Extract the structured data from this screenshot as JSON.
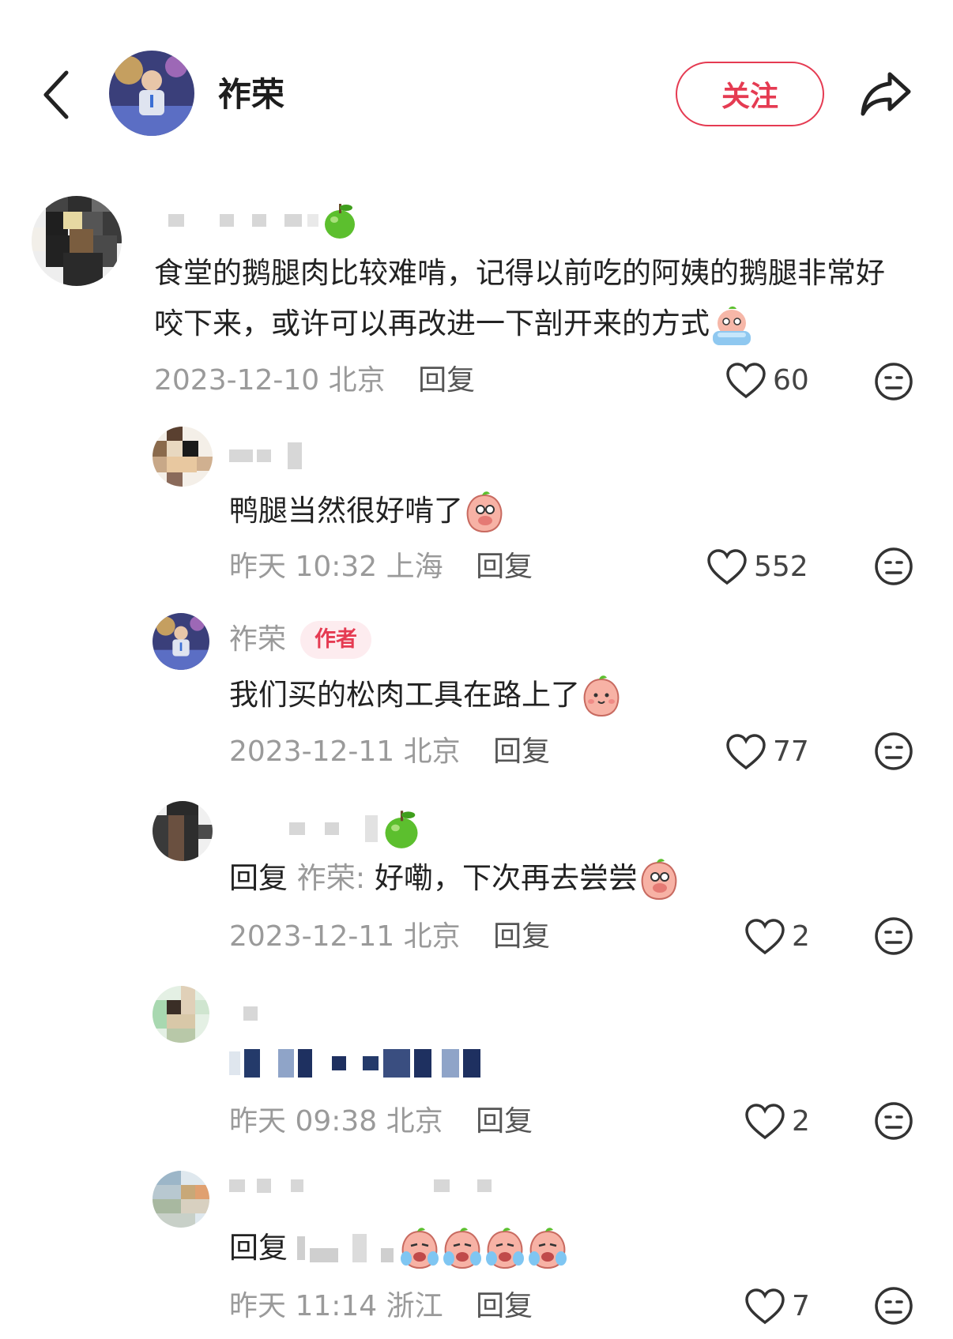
{
  "header": {
    "author_name": "祚荣",
    "follow_label": "关注"
  },
  "comments": [
    {
      "text": "食堂的鹅腿肉比较难啃，记得以前吃的阿姨的鹅腿非常好咬下来，或许可以再改进一下剖开来的方式",
      "date": "2023-12-10",
      "location": "北京",
      "reply_label": "回复",
      "likes": "60"
    },
    {
      "text": "鸭腿当然很好啃了",
      "date": "昨天 10:32",
      "location": "上海",
      "reply_label": "回复",
      "likes": "552"
    },
    {
      "username": "祚荣",
      "badge": "作者",
      "text": "我们买的松肉工具在路上了",
      "date": "2023-12-11",
      "location": "北京",
      "reply_label": "回复",
      "likes": "77"
    },
    {
      "reply_prefix": "回复",
      "reply_to": "祚荣:",
      "text": "好嘞，下次再去尝尝",
      "date": "2023-12-11",
      "location": "北京",
      "reply_label": "回复",
      "likes": "2"
    },
    {
      "date": "昨天 09:38",
      "location": "北京",
      "reply_label": "回复",
      "likes": "2"
    },
    {
      "reply_prefix": "回复",
      "date": "昨天 11:14",
      "location": "浙江",
      "reply_label": "回复",
      "likes": "7"
    }
  ],
  "colors": {
    "accent": "#e53b52",
    "muted_text": "#9a9a9a",
    "badge_bg": "#fdecef"
  },
  "icons": [
    "back-arrow-icon",
    "share-icon",
    "heart-icon",
    "dislike-face-icon",
    "apple-icon",
    "peach-emoji-icon"
  ]
}
